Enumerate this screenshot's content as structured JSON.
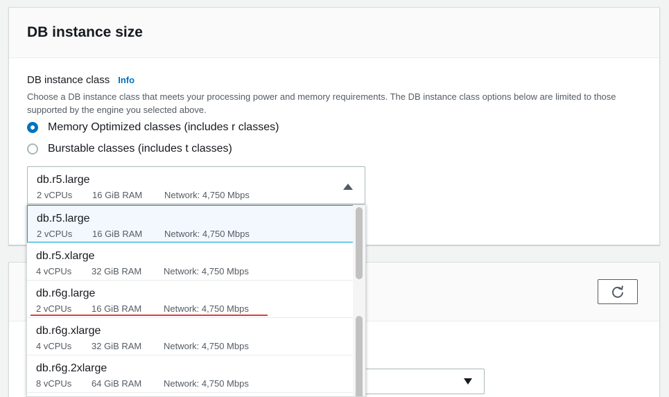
{
  "panel1": {
    "title": "DB instance size"
  },
  "instance_class": {
    "label": "DB instance class",
    "info_label": "Info",
    "description": "Choose a DB instance class that meets your processing power and memory requirements. The DB instance class options below are limited to those supported by the engine you selected above.",
    "radios": [
      {
        "label": "Memory Optimized classes (includes r classes)",
        "checked": true
      },
      {
        "label": "Burstable classes (includes t classes)",
        "checked": false
      }
    ],
    "selected": {
      "name": "db.r5.large",
      "vcpus": "2 vCPUs",
      "ram": "16 GiB RAM",
      "network": "Network: 4,750 Mbps"
    },
    "options": [
      {
        "name": "db.r5.large",
        "vcpus": "2 vCPUs",
        "ram": "16 GiB RAM",
        "network": "Network: 4,750 Mbps"
      },
      {
        "name": "db.r5.xlarge",
        "vcpus": "4 vCPUs",
        "ram": "32 GiB RAM",
        "network": "Network: 4,750 Mbps"
      },
      {
        "name": "db.r6g.large",
        "vcpus": "2 vCPUs",
        "ram": "16 GiB RAM",
        "network": "Network: 4,750 Mbps"
      },
      {
        "name": "db.r6g.xlarge",
        "vcpus": "4 vCPUs",
        "ram": "32 GiB RAM",
        "network": "Network: 4,750 Mbps"
      },
      {
        "name": "db.r6g.2xlarge",
        "vcpus": "8 vCPUs",
        "ram": "64 GiB RAM",
        "network": "Network: 4,750 Mbps"
      }
    ]
  },
  "colors": {
    "accent": "#0073bb",
    "highlight_border": "#00a1c9",
    "annotation": "#e53935"
  }
}
